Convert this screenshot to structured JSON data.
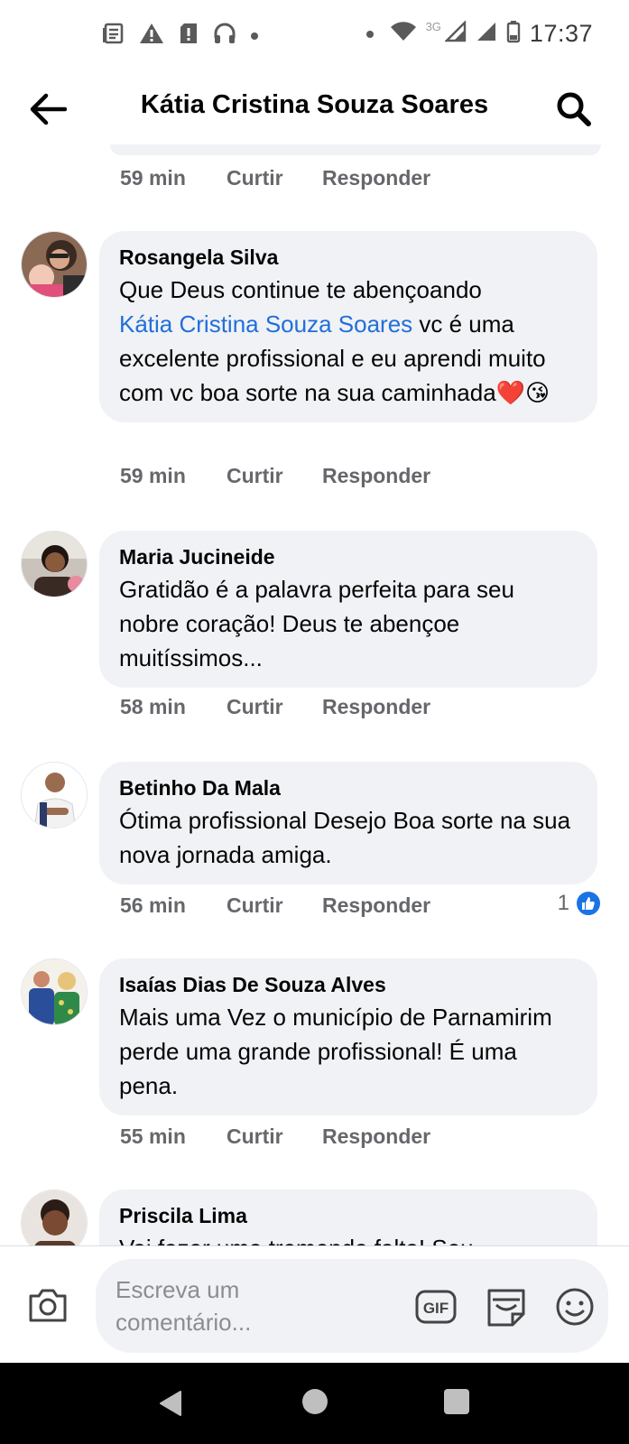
{
  "status_bar": {
    "time": "17:37",
    "network": "3G",
    "icons_left": [
      "news-icon",
      "warning-icon",
      "alert-icon",
      "headset-icon",
      "dot-icon"
    ],
    "icons_right": [
      "dot-icon",
      "wifi-icon",
      "signal-icon",
      "signal-icon",
      "battery-icon"
    ]
  },
  "header": {
    "title": "Kátia Cristina Souza Soares",
    "back_icon": "arrow-left-icon",
    "search_icon": "search-icon"
  },
  "previous_comment_meta": {
    "time": "59 min",
    "like_label": "Curtir",
    "reply_label": "Responder"
  },
  "comments": [
    {
      "author": "Rosangela Silva",
      "text_before": "Que Deus  continue te abençoando",
      "mention": "Kátia Cristina Souza Soares",
      "text_after": " vc é uma excelente profissional e eu aprendi muito com vc boa sorte na sua caminhada",
      "emojis": "❤️😘",
      "time": "59 min",
      "like_label": "Curtir",
      "reply_label": "Responder"
    },
    {
      "author": "Maria Jucineide",
      "text": "Gratidão é a palavra perfeita para seu nobre coração! Deus te abençoe muitíssimos...",
      "time": "58 min",
      "like_label": "Curtir",
      "reply_label": "Responder"
    },
    {
      "author": "Betinho Da Mala",
      "text": "Ótima profissional Desejo Boa sorte na sua nova jornada amiga.",
      "time": "56 min",
      "like_label": "Curtir",
      "reply_label": "Responder",
      "reactions_count": "1"
    },
    {
      "author": "Isaías Dias De Souza Alves",
      "text": "Mais uma Vez o município de Parnamirim perde uma grande profissional! É uma pena.",
      "time": "55 min",
      "like_label": "Curtir",
      "reply_label": "Responder"
    },
    {
      "author": "Priscila Lima",
      "text": "Vai fazer uma tremenda falta! Seu"
    }
  ],
  "composer": {
    "placeholder": "Escreva um comentário...",
    "camera_icon": "camera-icon",
    "gif_label": "GIF",
    "sticker_icon": "sticker-icon",
    "emoji_icon": "emoji-icon"
  },
  "colors": {
    "bubble": "#f0f2f5",
    "mention": "#216fdb",
    "meta_text": "#65676b",
    "like_badge": "#1b74e4"
  }
}
